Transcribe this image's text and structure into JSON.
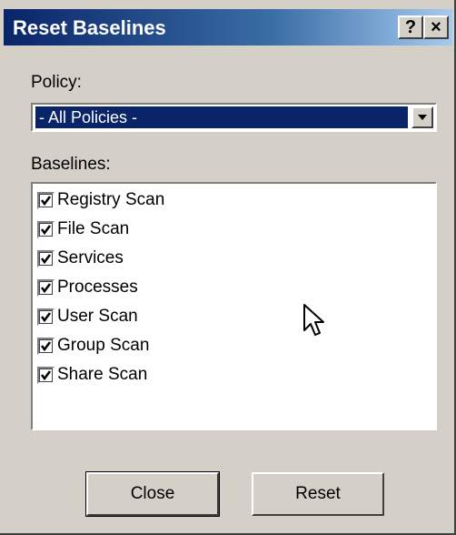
{
  "dialog": {
    "title": "Reset Baselines",
    "help_label": "?",
    "close_label": "×"
  },
  "policy": {
    "label": "Policy:",
    "selected": "- All Policies -"
  },
  "baselines": {
    "label": "Baselines:",
    "items": [
      {
        "label": "Registry Scan",
        "checked": true
      },
      {
        "label": "File Scan",
        "checked": true
      },
      {
        "label": "Services",
        "checked": true
      },
      {
        "label": "Processes",
        "checked": true
      },
      {
        "label": "User Scan",
        "checked": true
      },
      {
        "label": "Group Scan",
        "checked": true
      },
      {
        "label": "Share Scan",
        "checked": true
      }
    ]
  },
  "buttons": {
    "close": "Close",
    "reset": "Reset"
  },
  "colors": {
    "title_bar": "#0a246a",
    "dialog_bg": "#d4d0c8",
    "selection": "#0a246a"
  }
}
